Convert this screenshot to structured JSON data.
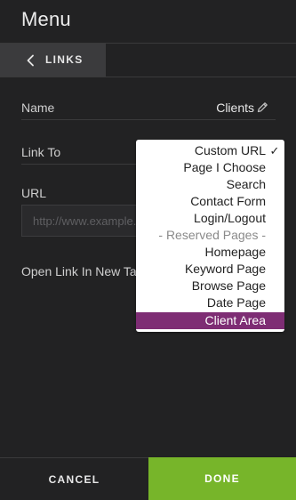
{
  "header": {
    "title": "Menu"
  },
  "tab": {
    "back_label": "LINKS",
    "back_icon": "chevron-left-icon"
  },
  "form": {
    "name": {
      "label": "Name",
      "value": "Clients",
      "edit_icon": "pencil-icon"
    },
    "link_to": {
      "label": "Link To",
      "selected": "Custom URL"
    },
    "url": {
      "label": "URL",
      "placeholder": "http://www.example.com",
      "value": ""
    },
    "new_tab": {
      "label": "Open Link In New Tab"
    }
  },
  "dropdown": {
    "check_glyph": "✓",
    "options": [
      {
        "label": "Custom URL",
        "checked": true
      },
      {
        "label": "Page I Choose"
      },
      {
        "label": "Search"
      },
      {
        "label": "Contact Form"
      },
      {
        "label": "Login/Logout"
      },
      {
        "label": "- Reserved Pages -",
        "group_header": true
      },
      {
        "label": "Homepage"
      },
      {
        "label": "Keyword Page"
      },
      {
        "label": "Browse Page"
      },
      {
        "label": "Date Page"
      },
      {
        "label": "Client Area",
        "highlighted": true
      }
    ]
  },
  "footer": {
    "cancel_label": "CANCEL",
    "done_label": "DONE"
  },
  "colors": {
    "background": "#222223",
    "accent_done": "#77b52a",
    "highlight": "#7e2d74"
  }
}
